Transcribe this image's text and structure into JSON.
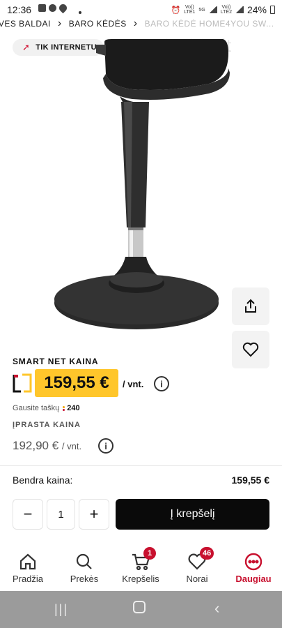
{
  "status_bar": {
    "time": "12:36",
    "net1": "Vo))\nLTE1",
    "net_5g": "5G",
    "net2": "Vo))\nLTE2",
    "battery": "24%"
  },
  "breadcrumb": [
    {
      "label": "IVES BALDAI"
    },
    {
      "label": "BARO KĖDĖS"
    },
    {
      "label": "BARO KĖDĖ HOME4YOU SW..."
    }
  ],
  "badge": {
    "label": "TIK INTERNETU"
  },
  "watermark": "skelbiu.lt",
  "pricing": {
    "smart_label": "SMART NET KAINA",
    "price": "159,55 €",
    "unit": "/ vnt.",
    "points_text": "Gausite taškų",
    "points_value": "240",
    "regular_label": "ĮPRASTA KAINA",
    "regular_price": "192,90 €",
    "regular_unit": "/ vnt."
  },
  "total": {
    "label": "Bendra kaina:",
    "value": "159,55 €"
  },
  "quantity": {
    "value": "1",
    "minus": "−",
    "plus": "+"
  },
  "cart_button": {
    "label": "Į krepšelį"
  },
  "nav": [
    {
      "label": "Pradžia",
      "icon": "home-icon"
    },
    {
      "label": "Prekės",
      "icon": "search-icon"
    },
    {
      "label": "Krepšelis",
      "icon": "cart-icon",
      "badge": "1"
    },
    {
      "label": "Norai",
      "icon": "heart-icon",
      "badge": "46"
    },
    {
      "label": "Daugiau",
      "icon": "more-icon",
      "active": true
    }
  ],
  "colors": {
    "accent": "#c8102e",
    "price_bg": "#ffc62b",
    "cart_bg": "#0a0a0a"
  }
}
